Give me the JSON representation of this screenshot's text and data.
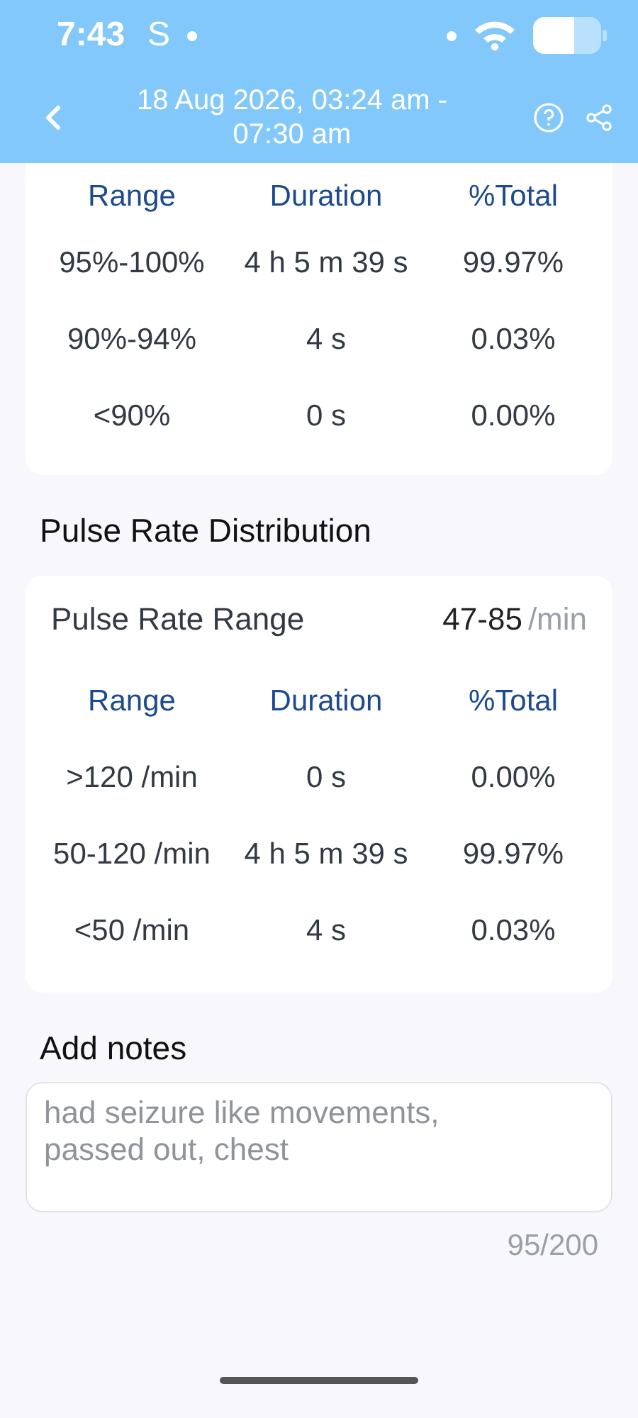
{
  "status_bar": {
    "time": "7:43",
    "notification": "S"
  },
  "header": {
    "title": "18 Aug 2026, 03:24 am - 07:30 am"
  },
  "spo2_table": {
    "columns": [
      "Range",
      "Duration",
      "%Total"
    ],
    "rows": [
      {
        "range": "95%-100%",
        "duration": "4 h 5 m 39 s",
        "total": "99.97%"
      },
      {
        "range": "90%-94%",
        "duration": "4 s",
        "total": "0.03%"
      },
      {
        "range": "<90%",
        "duration": "0 s",
        "total": "0.00%"
      }
    ]
  },
  "pulse_section": {
    "title": "Pulse Rate Distribution",
    "range_label": "Pulse Rate Range",
    "range_value": "47-85",
    "range_unit": "/min",
    "columns": [
      "Range",
      "Duration",
      "%Total"
    ],
    "rows": [
      {
        "range": ">120 /min",
        "duration": "0 s",
        "total": "0.00%"
      },
      {
        "range": "50-120 /min",
        "duration": "4 h 5 m 39 s",
        "total": "99.97%"
      },
      {
        "range": "<50 /min",
        "duration": "4 s",
        "total": "0.03%"
      }
    ]
  },
  "notes": {
    "label": "Add notes",
    "value": "had seizure like movements, passed out, chest",
    "counter": "95/200"
  }
}
